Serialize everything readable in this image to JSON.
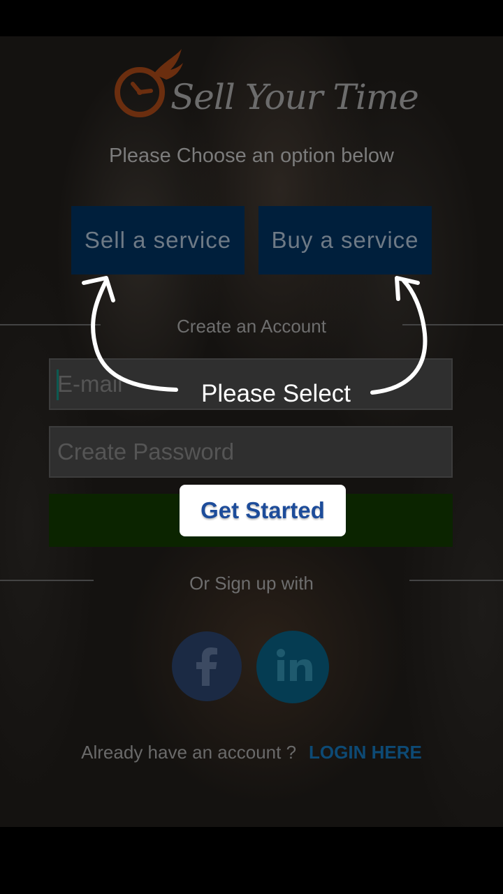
{
  "app": {
    "name": "Sell Your Time",
    "choose_prompt": "Please Choose an option below",
    "sell_label": "Sell a service",
    "buy_label": "Buy a service",
    "create_account_label": "Create an Account",
    "email_placeholder": "E-mail",
    "password_placeholder": "Create Password",
    "signup_with_label": "Or Sign up with",
    "already_account": "Already have an account ?",
    "login_link": "LOGIN HERE"
  },
  "overlay": {
    "hint": "Please Select",
    "get_started": "Get Started"
  },
  "icons": {
    "logo": "clock-icon",
    "facebook": "facebook-icon",
    "linkedin": "linkedin-icon"
  },
  "colors": {
    "sell_buy_button": "#001f3c",
    "get_started_bar": "#0b2400",
    "login_link": "#0d4a75",
    "tooltip_text": "#1d4c9a"
  }
}
